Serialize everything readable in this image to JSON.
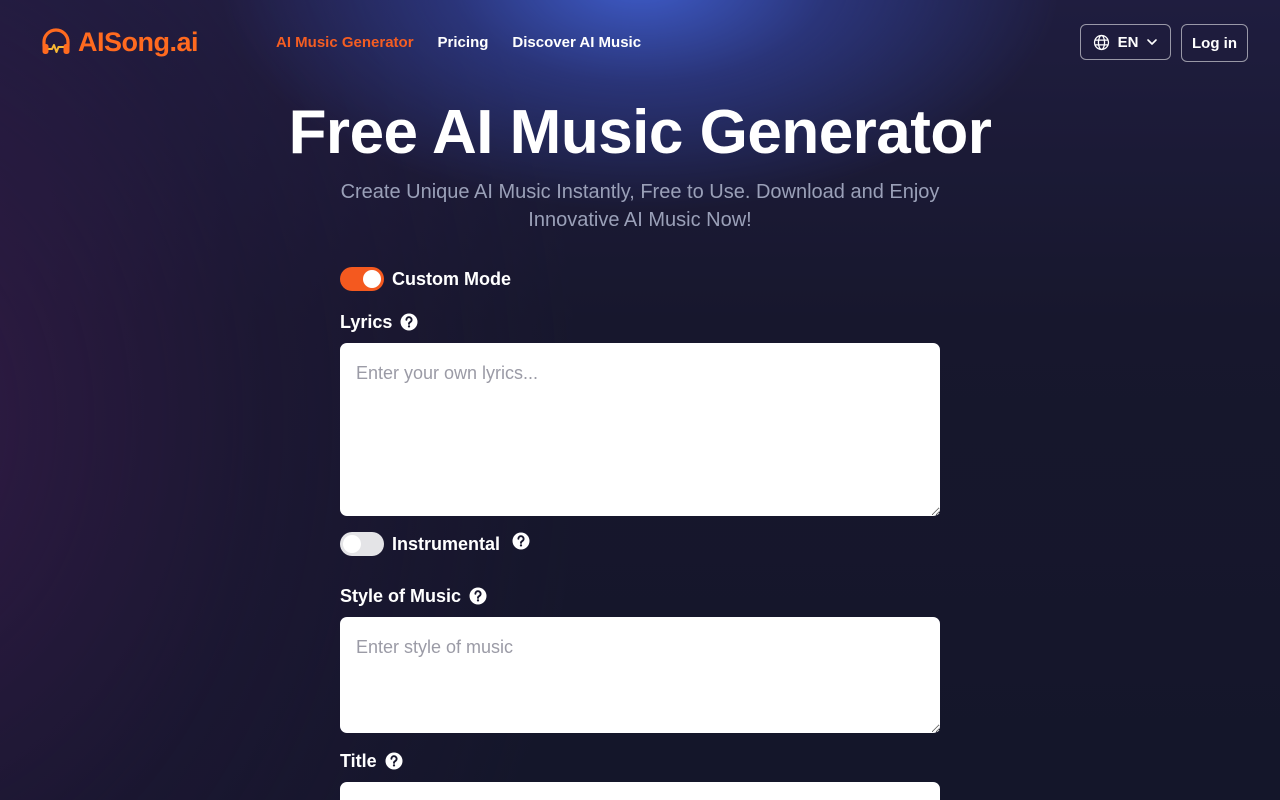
{
  "brand": {
    "name": "AISong.ai",
    "accent_color": "#f4591f",
    "logo_icon": "headphones-icon"
  },
  "nav": {
    "items": [
      {
        "label": "AI Music Generator",
        "active": true
      },
      {
        "label": "Pricing",
        "active": false
      },
      {
        "label": "Discover AI Music",
        "active": false
      }
    ]
  },
  "header": {
    "language": "EN",
    "language_icon": "globe-icon",
    "login_label": "Log in"
  },
  "hero": {
    "title": "Free AI Music Generator",
    "subtitle": "Create Unique AI Music Instantly, Free to Use. Download and Enjoy Innovative AI Music Now!"
  },
  "form": {
    "custom_mode": {
      "label": "Custom Mode",
      "on": true
    },
    "lyrics": {
      "label": "Lyrics",
      "placeholder": "Enter your own lyrics...",
      "value": ""
    },
    "instrumental": {
      "label": "Instrumental",
      "on": false
    },
    "style": {
      "label": "Style of Music",
      "placeholder": "Enter style of music",
      "value": ""
    },
    "title": {
      "label": "Title",
      "placeholder": "",
      "value": ""
    }
  }
}
